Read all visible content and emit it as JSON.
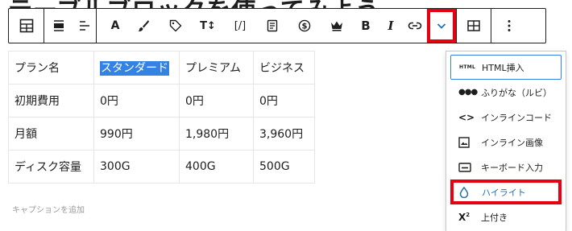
{
  "page": {
    "background_heading": "テーブルブロックを使ってみよう"
  },
  "toolbar": {
    "buttons": [
      {
        "name": "table-block-icon",
        "kind": "icon"
      },
      {
        "name": "align-wide-icon",
        "kind": "icon"
      },
      {
        "name": "align-left-icon",
        "kind": "icon"
      },
      {
        "name": "font-size-icon",
        "kind": "text",
        "label": "A"
      },
      {
        "name": "brush-icon",
        "kind": "icon"
      },
      {
        "name": "tag-icon",
        "kind": "icon"
      },
      {
        "name": "text-size-icon",
        "kind": "text",
        "label": "T↕"
      },
      {
        "name": "shortcode-icon",
        "kind": "text",
        "label": "[/]"
      },
      {
        "name": "list-icon",
        "kind": "icon"
      },
      {
        "name": "dollar-icon",
        "kind": "icon"
      },
      {
        "name": "crown-icon",
        "kind": "icon"
      },
      {
        "name": "bold-icon",
        "kind": "text",
        "label": "B"
      },
      {
        "name": "italic-icon",
        "kind": "text",
        "label": "I"
      },
      {
        "name": "link-icon",
        "kind": "icon"
      },
      {
        "name": "chevron-down-icon",
        "kind": "icon"
      },
      {
        "name": "table-edit-icon",
        "kind": "icon"
      },
      {
        "name": "more-options-icon",
        "kind": "icon"
      }
    ],
    "highlight_color": "#e60012"
  },
  "table": {
    "rows": [
      [
        "プラン名",
        "スタンダード",
        "プレミアム",
        "ビジネス"
      ],
      [
        "初期費用",
        "0円",
        "0円",
        "0円"
      ],
      [
        "月額",
        "990円",
        "1,980円",
        "3,960円"
      ],
      [
        "ディスク容量",
        "300G",
        "400G",
        "500G"
      ]
    ],
    "selected_cell_color": "#3582e5"
  },
  "caption": {
    "placeholder": "キャプションを追加"
  },
  "dropdown": {
    "items": [
      {
        "icon": "html-icon",
        "icon_text": "HTML",
        "label": "HTML挿入",
        "state": "focused"
      },
      {
        "icon": "ruby-icon",
        "icon_text": "●●●",
        "label": "ふりがな（ルビ）",
        "state": ""
      },
      {
        "icon": "code-icon",
        "icon_text": "<>",
        "label": "インラインコード",
        "state": ""
      },
      {
        "icon": "image-icon",
        "icon_text": "",
        "label": "インライン画像",
        "state": ""
      },
      {
        "icon": "keyboard-icon",
        "icon_text": "",
        "label": "キーボード入力",
        "state": ""
      },
      {
        "icon": "drop-icon",
        "icon_text": "",
        "label": "ハイライト",
        "state": "highlighted"
      },
      {
        "icon": "superscript-icon",
        "icon_text": "X²",
        "label": "上付き",
        "state": ""
      }
    ],
    "accent_color": "#2271b1"
  }
}
